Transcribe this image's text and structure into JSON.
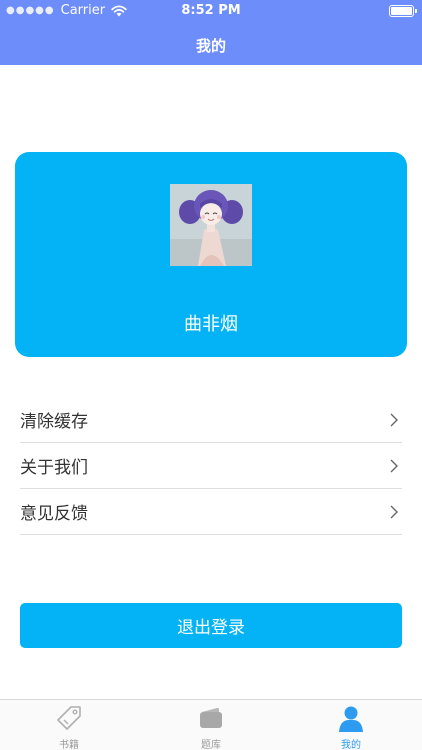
{
  "status_bar": {
    "carrier": "Carrier",
    "time": "8:52 PM",
    "signal_icon": "signal-dots-icon",
    "wifi_icon": "wifi-icon",
    "battery_icon": "battery-icon",
    "battery_level": 1.0
  },
  "header": {
    "title": "我的",
    "color": "#6d8dfb"
  },
  "profile": {
    "avatar_icon": "avatar-image",
    "name": "曲非烟",
    "card_color": "#03b3f5"
  },
  "menu": {
    "items": [
      {
        "label": "清除缓存",
        "icon": "chevron-right-icon"
      },
      {
        "label": "关于我们",
        "icon": "chevron-right-icon"
      },
      {
        "label": "意见反馈",
        "icon": "chevron-right-icon"
      }
    ]
  },
  "logout": {
    "label": "退出登录",
    "color": "#03b3f5"
  },
  "tabbar": {
    "tabs": [
      {
        "label": "书籍",
        "icon": "tag-icon",
        "active": false
      },
      {
        "label": "题库",
        "icon": "wallet-icon",
        "active": false
      },
      {
        "label": "我的",
        "icon": "person-icon",
        "active": true
      }
    ],
    "active_color": "#2d9cf0",
    "inactive_color": "#9a9a9a"
  }
}
